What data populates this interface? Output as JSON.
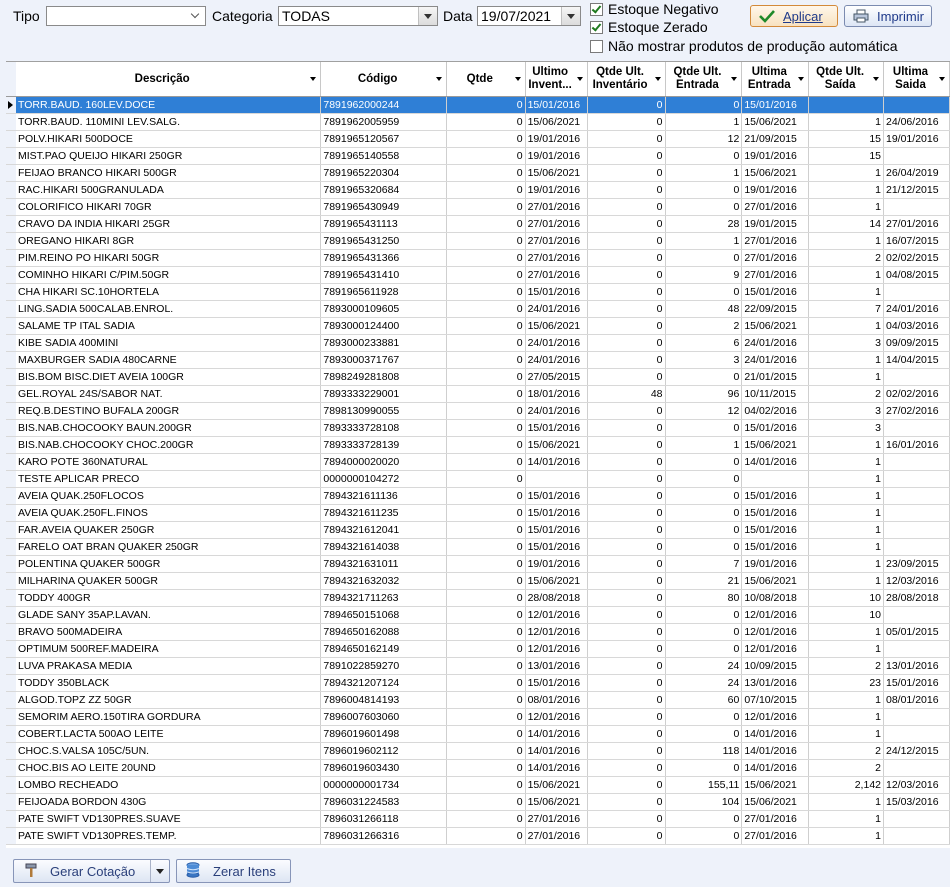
{
  "filters": {
    "tipo_label": "Tipo",
    "tipo_value": "",
    "categoria_label": "Categoria",
    "categoria_value": "TODAS",
    "data_label": "Data",
    "data_value": "19/07/2021",
    "estoque_negativo": "Estoque Negativo",
    "estoque_zerado": "Estoque Zerado",
    "nao_mostrar": "Não mostrar produtos de produção automática"
  },
  "buttons": {
    "aplicar": "Aplicar",
    "imprimir": "Imprimir",
    "gerar_cotacao": "Gerar Cotação",
    "zerar_itens": "Zerar Itens"
  },
  "columns": {
    "descricao": "Descrição",
    "codigo": "Código",
    "qtde": "Qtde",
    "ultimo_inventario": "Ultimo Invent...",
    "qtde_ult_inventario": "Qtde Ult. Inventário",
    "qtde_ult_entrada": "Qtde Ult. Entrada",
    "ultima_entrada": "Ultima Entrada",
    "qtde_ult_saida": "Qtde Ult. Saída",
    "ultima_saida": "Ultima Saida"
  },
  "rows": [
    [
      "TORR.BAUD. 160LEV.DOCE",
      "7891962000244",
      "0",
      "15/01/2016",
      "0",
      "0",
      "15/01/2016",
      "",
      ""
    ],
    [
      "TORR.BAUD. 110MINI LEV.SALG.",
      "7891962005959",
      "0",
      "15/06/2021",
      "0",
      "1",
      "15/06/2021",
      "1",
      "24/06/2016"
    ],
    [
      "POLV.HIKARI 500DOCE",
      "7891965120567",
      "0",
      "19/01/2016",
      "0",
      "12",
      "21/09/2015",
      "15",
      "19/01/2016"
    ],
    [
      "MIST.PAO QUEIJO HIKARI 250GR",
      "7891965140558",
      "0",
      "19/01/2016",
      "0",
      "0",
      "19/01/2016",
      "15",
      ""
    ],
    [
      "FEIJAO BRANCO HIKARI 500GR",
      "7891965220304",
      "0",
      "15/06/2021",
      "0",
      "1",
      "15/06/2021",
      "1",
      "26/04/2019"
    ],
    [
      "RAC.HIKARI 500GRANULADA",
      "7891965320684",
      "0",
      "19/01/2016",
      "0",
      "0",
      "19/01/2016",
      "1",
      "21/12/2015"
    ],
    [
      "COLORIFICO HIKARI 70GR",
      "7891965430949",
      "0",
      "27/01/2016",
      "0",
      "0",
      "27/01/2016",
      "1",
      ""
    ],
    [
      "CRAVO DA INDIA HIKARI 25GR",
      "7891965431113",
      "0",
      "27/01/2016",
      "0",
      "28",
      "19/01/2015",
      "14",
      "27/01/2016"
    ],
    [
      "OREGANO HIKARI 8GR",
      "7891965431250",
      "0",
      "27/01/2016",
      "0",
      "1",
      "27/01/2016",
      "1",
      "16/07/2015"
    ],
    [
      "PIM.REINO PO HIKARI 50GR",
      "7891965431366",
      "0",
      "27/01/2016",
      "0",
      "0",
      "27/01/2016",
      "2",
      "02/02/2015"
    ],
    [
      "COMINHO HIKARI C/PIM.50GR",
      "7891965431410",
      "0",
      "27/01/2016",
      "0",
      "9",
      "27/01/2016",
      "1",
      "04/08/2015"
    ],
    [
      "CHA HIKARI SC.10HORTELA",
      "7891965611928",
      "0",
      "15/01/2016",
      "0",
      "0",
      "15/01/2016",
      "1",
      ""
    ],
    [
      "LING.SADIA 500CALAB.ENROL.",
      "7893000109605",
      "0",
      "24/01/2016",
      "0",
      "48",
      "22/09/2015",
      "7",
      "24/01/2016"
    ],
    [
      "SALAME TP ITAL SADIA",
      "7893000124400",
      "0",
      "15/06/2021",
      "0",
      "2",
      "15/06/2021",
      "1",
      "04/03/2016"
    ],
    [
      "KIBE SADIA 400MINI",
      "7893000233881",
      "0",
      "24/01/2016",
      "0",
      "6",
      "24/01/2016",
      "3",
      "09/09/2015"
    ],
    [
      "MAXBURGER SADIA 480CARNE",
      "7893000371767",
      "0",
      "24/01/2016",
      "0",
      "3",
      "24/01/2016",
      "1",
      "14/04/2015"
    ],
    [
      "BIS.BOM BISC.DIET AVEIA 100GR",
      "7898249281808",
      "0",
      "27/05/2015",
      "0",
      "0",
      "21/01/2015",
      "1",
      ""
    ],
    [
      "GEL.ROYAL 24S/SABOR NAT.",
      "7893333229001",
      "0",
      "18/01/2016",
      "48",
      "96",
      "10/11/2015",
      "2",
      "02/02/2016"
    ],
    [
      "REQ.B.DESTINO BUFALA 200GR",
      "7898130990055",
      "0",
      "24/01/2016",
      "0",
      "12",
      "04/02/2016",
      "3",
      "27/02/2016"
    ],
    [
      "BIS.NAB.CHOCOOKY BAUN.200GR",
      "7893333728108",
      "0",
      "15/01/2016",
      "0",
      "0",
      "15/01/2016",
      "3",
      ""
    ],
    [
      "BIS.NAB.CHOCOOKY CHOC.200GR",
      "7893333728139",
      "0",
      "15/06/2021",
      "0",
      "1",
      "15/06/2021",
      "1",
      "16/01/2016"
    ],
    [
      "KARO POTE 360NATURAL",
      "7894000020020",
      "0",
      "14/01/2016",
      "0",
      "0",
      "14/01/2016",
      "1",
      ""
    ],
    [
      "TESTE APLICAR PRECO",
      "0000000104272",
      "0",
      "",
      "0",
      "0",
      "",
      "1",
      ""
    ],
    [
      "AVEIA QUAK.250FLOCOS",
      "7894321611136",
      "0",
      "15/01/2016",
      "0",
      "0",
      "15/01/2016",
      "1",
      ""
    ],
    [
      "AVEIA QUAK.250FL.FINOS",
      "7894321611235",
      "0",
      "15/01/2016",
      "0",
      "0",
      "15/01/2016",
      "1",
      ""
    ],
    [
      "FAR.AVEIA QUAKER 250GR",
      "7894321612041",
      "0",
      "15/01/2016",
      "0",
      "0",
      "15/01/2016",
      "1",
      ""
    ],
    [
      "FARELO OAT BRAN QUAKER 250GR",
      "7894321614038",
      "0",
      "15/01/2016",
      "0",
      "0",
      "15/01/2016",
      "1",
      ""
    ],
    [
      "POLENTINA QUAKER 500GR",
      "7894321631011",
      "0",
      "19/01/2016",
      "0",
      "7",
      "19/01/2016",
      "1",
      "23/09/2015"
    ],
    [
      "MILHARINA QUAKER 500GR",
      "7894321632032",
      "0",
      "15/06/2021",
      "0",
      "21",
      "15/06/2021",
      "1",
      "12/03/2016"
    ],
    [
      "TODDY 400GR",
      "7894321711263",
      "0",
      "28/08/2018",
      "0",
      "80",
      "10/08/2018",
      "10",
      "28/08/2018"
    ],
    [
      "GLADE SANY 35AP.LAVAN.",
      "7894650151068",
      "0",
      "12/01/2016",
      "0",
      "0",
      "12/01/2016",
      "10",
      ""
    ],
    [
      "BRAVO 500MADEIRA",
      "7894650162088",
      "0",
      "12/01/2016",
      "0",
      "0",
      "12/01/2016",
      "1",
      "05/01/2015"
    ],
    [
      "OPTIMUM 500REF.MADEIRA",
      "7894650162149",
      "0",
      "12/01/2016",
      "0",
      "0",
      "12/01/2016",
      "1",
      ""
    ],
    [
      "LUVA PRAKASA MEDIA",
      "7891022859270",
      "0",
      "13/01/2016",
      "0",
      "24",
      "10/09/2015",
      "2",
      "13/01/2016"
    ],
    [
      "TODDY 350BLACK",
      "7894321207124",
      "0",
      "15/01/2016",
      "0",
      "24",
      "13/01/2016",
      "23",
      "15/01/2016"
    ],
    [
      "ALGOD.TOPZ ZZ 50GR",
      "7896004814193",
      "0",
      "08/01/2016",
      "0",
      "60",
      "07/10/2015",
      "1",
      "08/01/2016"
    ],
    [
      "SEMORIM AERO.150TIRA GORDURA",
      "7896007603060",
      "0",
      "12/01/2016",
      "0",
      "0",
      "12/01/2016",
      "1",
      ""
    ],
    [
      "COBERT.LACTA 500AO LEITE",
      "7896019601498",
      "0",
      "14/01/2016",
      "0",
      "0",
      "14/01/2016",
      "1",
      ""
    ],
    [
      "CHOC.S.VALSA 105C/5UN.",
      "7896019602112",
      "0",
      "14/01/2016",
      "0",
      "118",
      "14/01/2016",
      "2",
      "24/12/2015"
    ],
    [
      "CHOC.BIS AO LEITE 20UND",
      "7896019603430",
      "0",
      "14/01/2016",
      "0",
      "0",
      "14/01/2016",
      "2",
      ""
    ],
    [
      "LOMBO RECHEADO",
      "0000000001734",
      "0",
      "15/06/2021",
      "0",
      "155,11",
      "15/06/2021",
      "2,142",
      "12/03/2016"
    ],
    [
      "FEIJOADA BORDON 430G",
      "7896031224583",
      "0",
      "15/06/2021",
      "0",
      "104",
      "15/06/2021",
      "1",
      "15/03/2016"
    ],
    [
      "PATE SWIFT VD130PRES.SUAVE",
      "7896031266118",
      "0",
      "27/01/2016",
      "0",
      "0",
      "27/01/2016",
      "1",
      ""
    ],
    [
      "PATE SWIFT VD130PRES.TEMP.",
      "7896031266316",
      "0",
      "27/01/2016",
      "0",
      "0",
      "27/01/2016",
      "1",
      ""
    ]
  ],
  "selected_row": 0
}
